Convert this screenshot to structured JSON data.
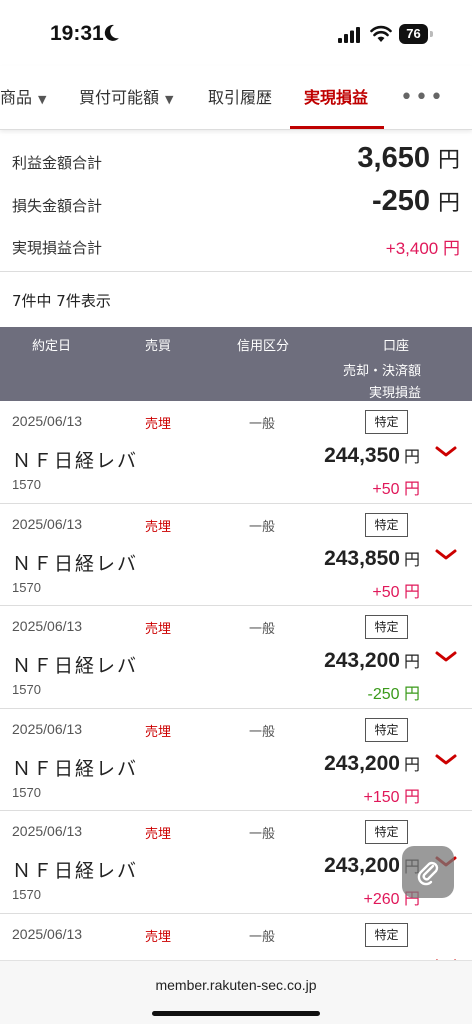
{
  "status_bar": {
    "time": "19:31",
    "battery": "76"
  },
  "tabs": [
    {
      "label": "商品",
      "caret": "▼"
    },
    {
      "label": "買付可能額",
      "caret": "▼"
    },
    {
      "label": "取引履歴"
    },
    {
      "label": "実現損益",
      "active": true
    },
    {
      "label": "•••"
    }
  ],
  "summary": {
    "profit_label": "利益金額合計",
    "profit_value": "3,650",
    "loss_label": "損失金額合計",
    "loss_value": "-250",
    "realized_label": "実現損益合計",
    "realized_value": "+3,400 円",
    "unit": "円"
  },
  "count_text": "7件中 7件表示",
  "table_header": {
    "date": "約定日",
    "side": "売買",
    "credit": "信用区分",
    "account": "口座",
    "settlement": "売却・決済額",
    "pnl": "実現損益"
  },
  "rows": [
    {
      "date": "2025/06/13",
      "side": "売埋",
      "credit": "一般",
      "account": "特定",
      "name": "ＮＦ日経レバ",
      "code": "1570",
      "amount": "244,350",
      "unit": "円",
      "pnl": "+50 円"
    },
    {
      "date": "2025/06/13",
      "side": "売埋",
      "credit": "一般",
      "account": "特定",
      "name": "ＮＦ日経レバ",
      "code": "1570",
      "amount": "243,850",
      "unit": "円",
      "pnl": "+50 円"
    },
    {
      "date": "2025/06/13",
      "side": "売埋",
      "credit": "一般",
      "account": "特定",
      "name": "ＮＦ日経レバ",
      "code": "1570",
      "amount": "243,200",
      "unit": "円",
      "pnl": "-250 円"
    },
    {
      "date": "2025/06/13",
      "side": "売埋",
      "credit": "一般",
      "account": "特定",
      "name": "ＮＦ日経レバ",
      "code": "1570",
      "amount": "243,200",
      "unit": "円",
      "pnl": "+150 円"
    },
    {
      "date": "2025/06/13",
      "side": "売埋",
      "credit": "一般",
      "account": "特定",
      "name": "ＮＦ日経レバ",
      "code": "1570",
      "amount": "243,200",
      "unit": "円",
      "pnl": "+260 円"
    },
    {
      "date": "2025/06/13",
      "side": "売埋",
      "credit": "一般",
      "account": "特定",
      "name": "",
      "code": "",
      "amount": "",
      "unit": "",
      "pnl": ""
    }
  ],
  "url": "member.rakuten-sec.co.jp",
  "colors": {
    "accent": "#bf0000",
    "profit": "#e0185a",
    "loss": "#3a9a1a",
    "header_bg": "#6e6e7d"
  }
}
